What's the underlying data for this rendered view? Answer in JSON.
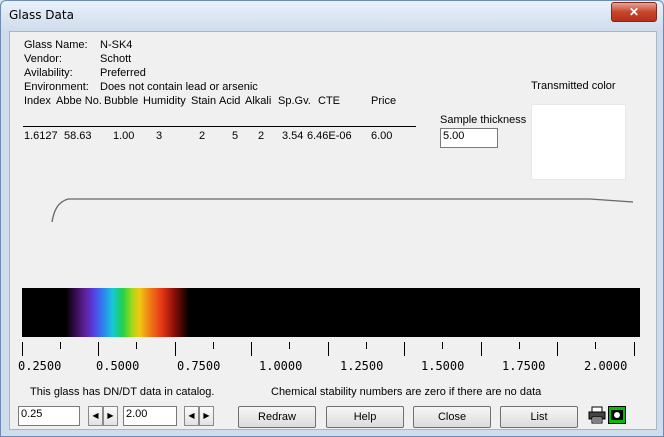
{
  "window": {
    "title": "Glass Data",
    "close_glyph": "✕"
  },
  "info": {
    "glass_name_label": "Glass Name:",
    "glass_name": "N-SK4",
    "vendor_label": "Vendor:",
    "vendor": "Schott",
    "availability_label": "Avilability:",
    "availability": "Preferred",
    "environment_label": "Environment:",
    "environment": "Does not contain lead or arsenic"
  },
  "table": {
    "headers": [
      "Index",
      "Abbe No.",
      "Bubble",
      "Humidity",
      "Stain",
      "Acid",
      "Alkali",
      "Sp.Gv.",
      "CTE",
      "Price"
    ],
    "values": [
      "1.6127",
      "58.63",
      "1.00",
      "3",
      "2",
      "5",
      "2",
      "3.54",
      "6.46E-06",
      "6.00"
    ]
  },
  "transmitted_color_label": "Transmitted color",
  "sample_thickness": {
    "label": "Sample thickness",
    "value": "5.00"
  },
  "axis_ticks": [
    "0.2500",
    "0.5000",
    "0.7500",
    "1.0000",
    "1.2500",
    "1.5000",
    "1.7500",
    "2.0000"
  ],
  "notes": {
    "dndt": "This glass has DN/DT data in catalog.",
    "chemical": "Chemical stability numbers are zero if there are no data"
  },
  "controls": {
    "min_wavelength": "0.25",
    "max_wavelength": "2.00",
    "redraw": "Redraw",
    "help": "Help",
    "close": "Close",
    "list": "List",
    "left_arrow": "◀",
    "right_arrow": "▶",
    "print_icon": "printer-icon",
    "camera_icon": "camera-icon"
  },
  "colors": {
    "title_bar": "#d8e4f1",
    "close_button": "#c7452d",
    "spectrum_bg": "#000000"
  }
}
